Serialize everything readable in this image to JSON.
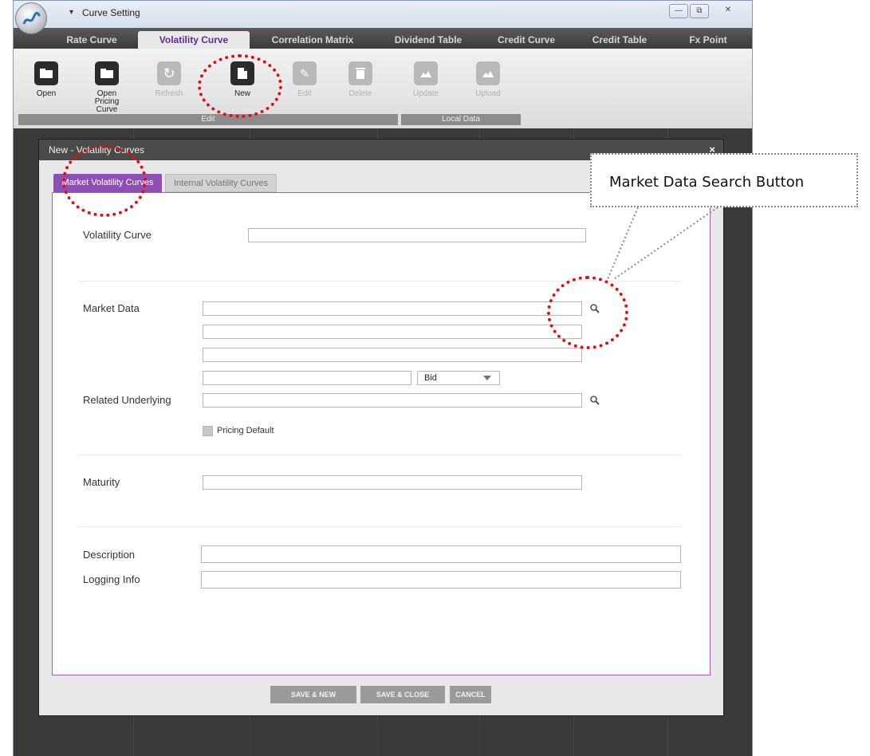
{
  "window": {
    "title": "Curve Setting",
    "controls": [
      "—",
      "⧉",
      "✕"
    ]
  },
  "ribbon_tabs": [
    {
      "label": "Rate Curve",
      "active": false
    },
    {
      "label": "Volatility Curve",
      "active": true
    },
    {
      "label": "Correlation Matrix",
      "active": false
    },
    {
      "label": "Dividend Table",
      "active": false
    },
    {
      "label": "Credit Curve",
      "active": false
    },
    {
      "label": "Credit Table",
      "active": false
    },
    {
      "label": "Fx Point",
      "active": false
    }
  ],
  "toolbar": {
    "open": "Open",
    "open_pricing_curve": "Open Pricing Curve",
    "refresh": "Refresh",
    "new": "New",
    "edit": "Edit",
    "delete": "Delete",
    "update": "Update",
    "upload": "Upload",
    "group_edit": "Edit",
    "group_local_data": "Local Data"
  },
  "dialog": {
    "title": "New - Volatility Curves",
    "close": "×",
    "tabs": {
      "market": "Market Volatility Curves",
      "internal": "Internal Volatility Curves"
    },
    "labels": {
      "volatility_curve": "Volatility Curve",
      "market_data": "Market Data",
      "related_underlying": "Related Underlying",
      "pricing_default": "Pricing Default",
      "maturity": "Maturity",
      "description": "Description",
      "logging_info": "Logging Info"
    },
    "fields": {
      "volatility_curve": "",
      "market_data_1": "",
      "market_data_2": "",
      "market_data_3": "",
      "market_data_4": "",
      "quote_side": "Bid",
      "related_underlying": "",
      "maturity": "",
      "description": "",
      "logging_info": ""
    },
    "pricing_default_checked": false,
    "buttons": {
      "save_new": "SAVE & NEW",
      "save_close": "SAVE & CLOSE",
      "cancel": "CANCEL"
    }
  },
  "annotation": {
    "callout": "Market Data Search Button",
    "highlight_color": "#e01010"
  }
}
